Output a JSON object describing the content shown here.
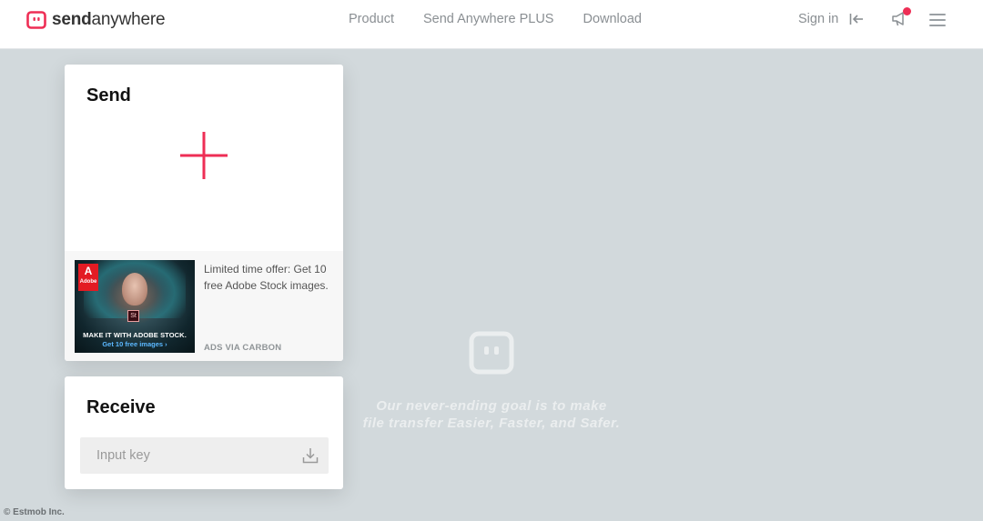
{
  "brand": {
    "name_bold": "send",
    "name_regular": "anywhere",
    "accent": "#ee2e55"
  },
  "nav": {
    "items": [
      {
        "label": "Product"
      },
      {
        "label": "Send Anywhere PLUS"
      },
      {
        "label": "Download"
      }
    ]
  },
  "header": {
    "signin_label": "Sign in",
    "signin_icon": "arrow-left-bar-icon",
    "notification_icon": "megaphone-icon",
    "menu_icon": "hamburger-menu-icon"
  },
  "send": {
    "title": "Send",
    "add_icon": "plus-icon"
  },
  "ad": {
    "image_line1": "MAKE IT WITH ADOBE STOCK.",
    "image_line2": "Get 10 free images ›",
    "adobe_label": "Adobe",
    "stock_badge": "St",
    "text": "Limited time offer: Get 10 free Adobe Stock images.",
    "via": "ADS VIA CARBON"
  },
  "receive": {
    "title": "Receive",
    "input_placeholder": "Input key",
    "input_value": "",
    "download_icon": "download-icon"
  },
  "tagline": {
    "line1": "Our never-ending goal is to make",
    "line2": "file transfer Easier, Faster, and Safer."
  },
  "footer": {
    "copyright": "© Estmob Inc."
  },
  "colors": {
    "background": "#d2d9dc",
    "header_bg": "#ffffff",
    "accent": "#ee2e55",
    "nav_text": "#8a8f93"
  }
}
